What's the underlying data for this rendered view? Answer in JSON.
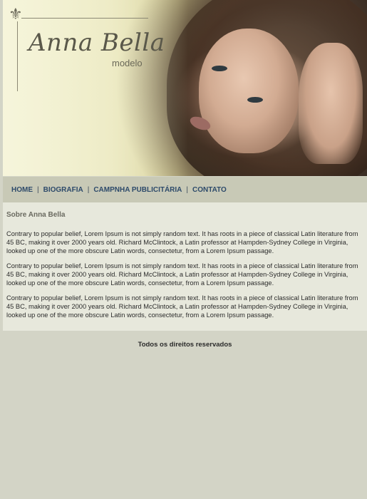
{
  "brand": {
    "title": "Anna Bella",
    "subtitle": "modelo"
  },
  "nav": {
    "items": [
      {
        "label": "HOME"
      },
      {
        "label": "BIOGRAFIA"
      },
      {
        "label": "CAMPNHA PUBLICITÁRIA"
      },
      {
        "label": "CONTATO"
      }
    ],
    "separator": "|"
  },
  "content": {
    "heading": "Sobre Anna Bella",
    "paragraphs": [
      "Contrary to popular belief, Lorem Ipsum is not simply random text. It has roots in a piece of classical Latin literature from 45 BC, making it over 2000 years old. Richard McClintock, a Latin professor at Hampden-Sydney College in Virginia, looked up one of the more obscure Latin words, consectetur, from a Lorem Ipsum passage.",
      "Contrary to popular belief, Lorem Ipsum is not simply random text. It has roots in a piece of classical Latin literature from 45 BC, making it over 2000 years old. Richard McClintock, a Latin professor at Hampden-Sydney College in Virginia, looked up one of the more obscure Latin words, consectetur, from a Lorem Ipsum passage.",
      "Contrary to popular belief, Lorem Ipsum is not simply random text. It has roots in a piece of classical Latin literature from 45 BC, making it over 2000 years old. Richard McClintock, a Latin professor at Hampden-Sydney College in Virginia, looked up one of the more obscure Latin words, consectetur, from a Lorem Ipsum passage."
    ]
  },
  "footer": {
    "text": "Todos os direitos reservados"
  },
  "colors": {
    "page_bg": "#d3d4c6",
    "nav_bg": "#c8c9b6",
    "nav_link": "#2d4a6a",
    "content_bg": "#e7e8dc"
  },
  "icons": {
    "ornament": "fleur-de-lis-icon"
  }
}
